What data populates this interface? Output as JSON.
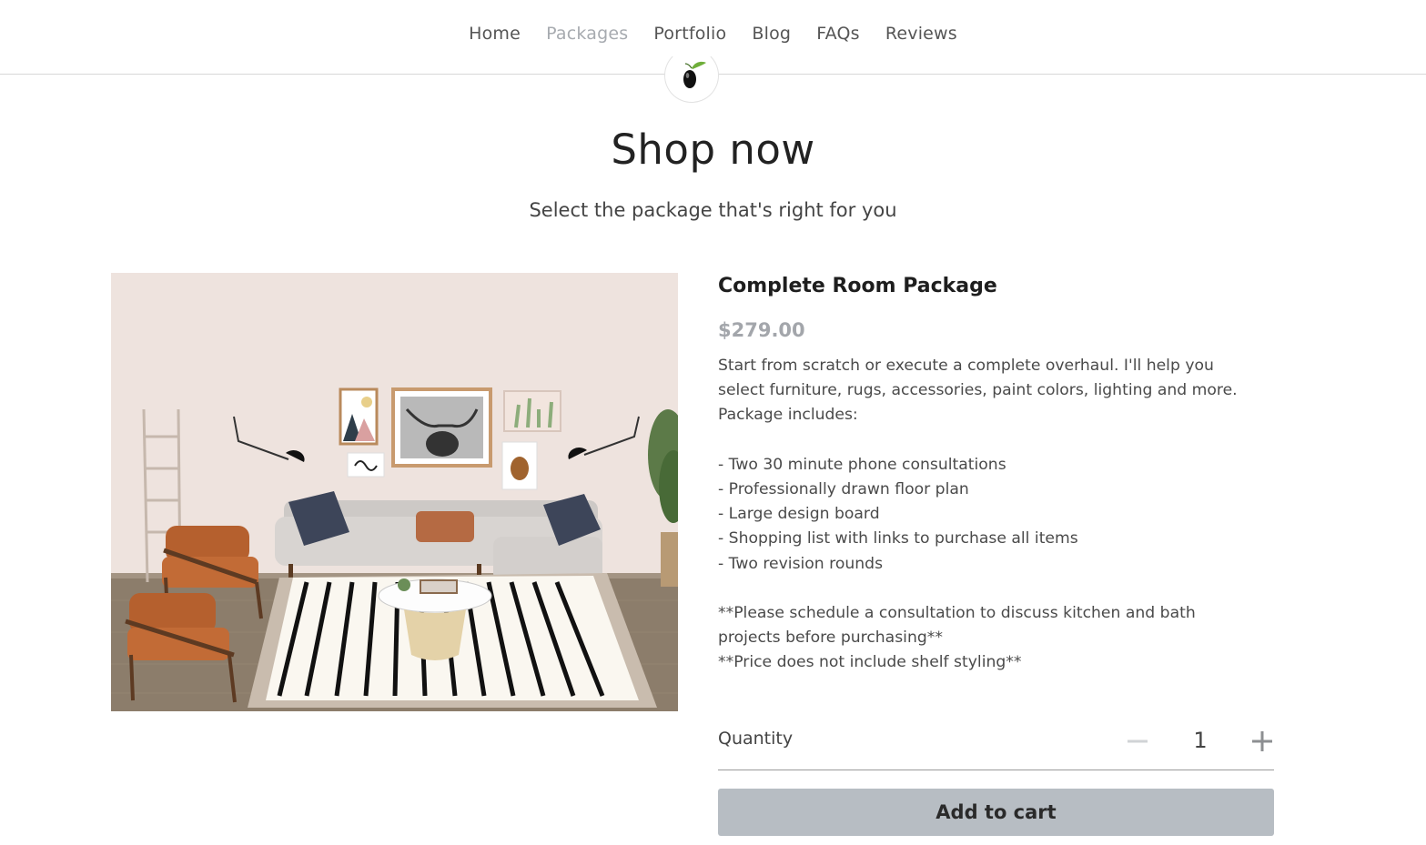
{
  "nav": {
    "items": [
      {
        "label": "Home"
      },
      {
        "label": "Packages",
        "active": true
      },
      {
        "label": "Portfolio"
      },
      {
        "label": "Blog"
      },
      {
        "label": "FAQs"
      },
      {
        "label": "Reviews"
      }
    ],
    "active_color": "#a7abb0"
  },
  "logo": {
    "icon": "olive-icon"
  },
  "hero": {
    "title": "Shop now",
    "subtitle": "Select the package that's right for you"
  },
  "product": {
    "name": "Complete Room Package",
    "price": "$279.00",
    "description": [
      "Start from scratch or execute a complete overhaul. I'll help you",
      "select furniture, rugs, accessories, paint colors, lighting and more.",
      "Package includes:",
      "",
      "- Two 30 minute phone consultations",
      "- Professionally drawn floor plan",
      "- Large design board",
      "- Shopping list with links to purchase all items",
      "- Two revision rounds",
      "",
      "**Please schedule a consultation to discuss kitchen and bath",
      "projects before purchasing**",
      "**Price does not include shelf styling**"
    ],
    "image": "living-room-design-board"
  },
  "quantity": {
    "label": "Quantity",
    "value": "1",
    "minus_icon": "minus-icon",
    "plus_icon": "plus-icon"
  },
  "cart": {
    "button_label": "Add to cart",
    "button_color": "#b7bdc3"
  }
}
